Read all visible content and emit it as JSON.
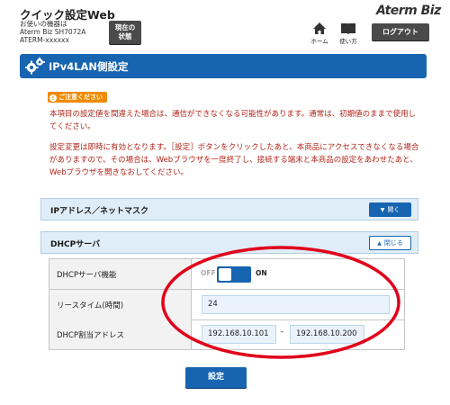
{
  "header": {
    "app_title": "クイック設定Web",
    "device_label": "お使いの機器は",
    "device_model": "Aterm Biz SH7072A",
    "device_id": "ATERM-xxxxxx",
    "status_button_line1": "現在の",
    "status_button_line2": "状態",
    "brand": "Aterm Biz",
    "home_label": "ホーム",
    "manual_label": "使い方",
    "logout_label": "ログアウト"
  },
  "page": {
    "title": "IPv4LAN側設定"
  },
  "notice": {
    "badge": "ご注意ください",
    "paragraph1": "本項目の設定値を間違えた場合は、通信ができなくなる可能性があります。通常は、初期値のままで使用してください。",
    "paragraph2": "設定変更は即時に有効となります。［設定］ボタンをクリックしたあと、本商品にアクセスできなくなる場合がありますので、その場合は、Webブラウザを一度終了し、接続する端末と本商品の設定をあわせたあと、Webブラウザを開きなおしてください。"
  },
  "sections": {
    "ip": {
      "title": "IPアドレス／ネットマスク",
      "button": "開く"
    },
    "dhcp": {
      "title": "DHCPサーバ",
      "button": "閉じる"
    }
  },
  "dhcp": {
    "server_label": "DHCPサーバ機能",
    "toggle_off": "OFF",
    "toggle_on": "ON",
    "toggle_state": "ON",
    "lease_label": "リースタイム(時間)",
    "lease_value": "24",
    "range_label": "DHCP割当アドレス",
    "range_start": "192.168.10.101",
    "range_separator": "-",
    "range_end": "192.168.10.200"
  },
  "actions": {
    "submit_label": "設定"
  },
  "colors": {
    "accent": "#1764b0",
    "notice_text": "#b02418",
    "badge": "#f08a00",
    "annotation": "#e0001a"
  },
  "icons": {
    "title": "gear-icon",
    "home": "home-icon",
    "manual": "book-icon"
  }
}
